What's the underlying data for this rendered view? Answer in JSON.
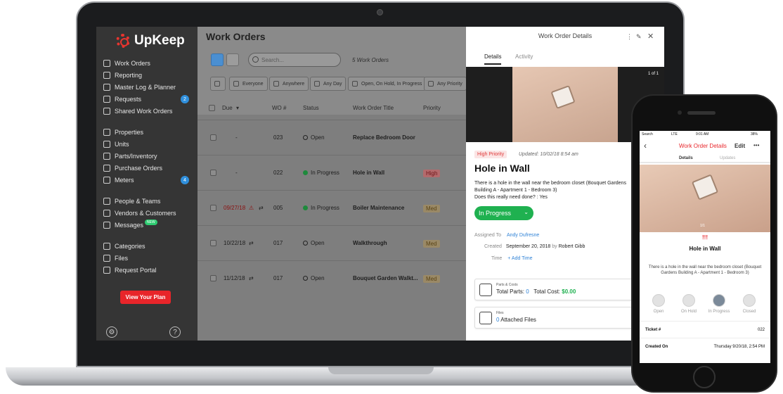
{
  "app": {
    "brand": "UpKeep",
    "accent": "#e8252a"
  },
  "sidebar": {
    "items": [
      {
        "label": "Work Orders",
        "icon": "clipboard-icon"
      },
      {
        "label": "Reporting",
        "icon": "chart-icon"
      },
      {
        "label": "Master Log & Planner",
        "icon": "log-icon"
      },
      {
        "label": "Requests",
        "icon": "inbox-icon",
        "badge": "2"
      },
      {
        "label": "Shared Work Orders",
        "icon": "share-icon"
      },
      {
        "label": "Properties",
        "icon": "pin-icon"
      },
      {
        "label": "Units",
        "icon": "cube-icon"
      },
      {
        "label": "Parts/Inventory",
        "icon": "wrench-icon"
      },
      {
        "label": "Purchase Orders",
        "icon": "document-icon"
      },
      {
        "label": "Meters",
        "icon": "gauge-icon",
        "badge": "4"
      },
      {
        "label": "People & Teams",
        "icon": "people-icon"
      },
      {
        "label": "Vendors & Customers",
        "icon": "store-icon"
      },
      {
        "label": "Messages",
        "icon": "chat-icon",
        "new": "NEW"
      },
      {
        "label": "Categories",
        "icon": "bookmark-icon"
      },
      {
        "label": "Files",
        "icon": "file-icon"
      },
      {
        "label": "Request Portal",
        "icon": "portal-icon"
      }
    ],
    "plan_button": "View Your Plan"
  },
  "main": {
    "title": "Work Orders",
    "search_placeholder": "Search...",
    "count": "5 Work Orders",
    "filters": [
      "Everyone",
      "Anywhere",
      "Any Day",
      "Open, On Hold, In Progress",
      "Any Priority"
    ],
    "columns": [
      "Due",
      "WO #",
      "Status",
      "Work Order Title",
      "Priority"
    ],
    "rows": [
      {
        "due": "-",
        "wo": "023",
        "status": "Open",
        "title": "Replace Bedroom Door",
        "priority": ""
      },
      {
        "due": "-",
        "wo": "022",
        "status": "In Progress",
        "title": "Hole in Wall",
        "priority": "High"
      },
      {
        "due": "09/27/18",
        "wo": "005",
        "status": "In Progress",
        "title": "Boiler Maintenance",
        "priority": "Med"
      },
      {
        "due": "10/22/18",
        "wo": "017",
        "status": "Open",
        "title": "Walkthrough",
        "priority": "Med"
      },
      {
        "due": "11/12/18",
        "wo": "017",
        "status": "Open",
        "title": "Bouquet Garden Walkt...",
        "priority": "Med"
      }
    ]
  },
  "detail": {
    "title": "Work Order Details",
    "tabs": [
      "Details",
      "Activity"
    ],
    "photo_counter": "1 of 1",
    "priority": "High Priority",
    "updated_label": "Updated:",
    "updated_value": "10/02/18 8:54 am",
    "heading": "Hole in Wall",
    "desc1": "There is a hole in the wall near the bedroom closet (Bouquet Gardens",
    "desc2": "Building A - Apartment 1 - Bedroom 3)",
    "desc3": "Does this really need done? : Yes",
    "status": "In Progress",
    "assigned_label": "Assigned To",
    "assigned_value": "Andy Dufresne",
    "created_label": "Created",
    "created_value": "September 20, 2018",
    "created_by": "by",
    "created_user": "Robert Gibb",
    "time_label": "Time",
    "time_value": "+ Add Time",
    "parts_label": "Parts & Costs",
    "parts_total_label": "Total Parts:",
    "parts_total": "0",
    "cost_label": "Total Cost:",
    "cost_value": "$0.00",
    "files_label": "Files",
    "files_count": "0",
    "files_suffix": "Attached Files"
  },
  "phone": {
    "carrier": "Search",
    "network": "LTE",
    "time": "9:01 AM",
    "battery": "38%",
    "nav_title": "Work Order Details",
    "edit": "Edit",
    "more": "•••",
    "tabs": [
      "Details",
      "Updates"
    ],
    "photo_counter": "1/1",
    "bangs": "!!!",
    "heading": "Hole in Wall",
    "desc": "There is a hole in the wall near the bedroom closet (Bouquet Gardens Building A - Apartment 1 - Bedroom 3)",
    "steps": [
      "Open",
      "On Hold",
      "In Progress",
      "Closed"
    ],
    "ticket_label": "Ticket #",
    "ticket_value": "022",
    "created_label": "Created On",
    "created_value": "Thursday 9/20/18, 2:54 PM"
  }
}
